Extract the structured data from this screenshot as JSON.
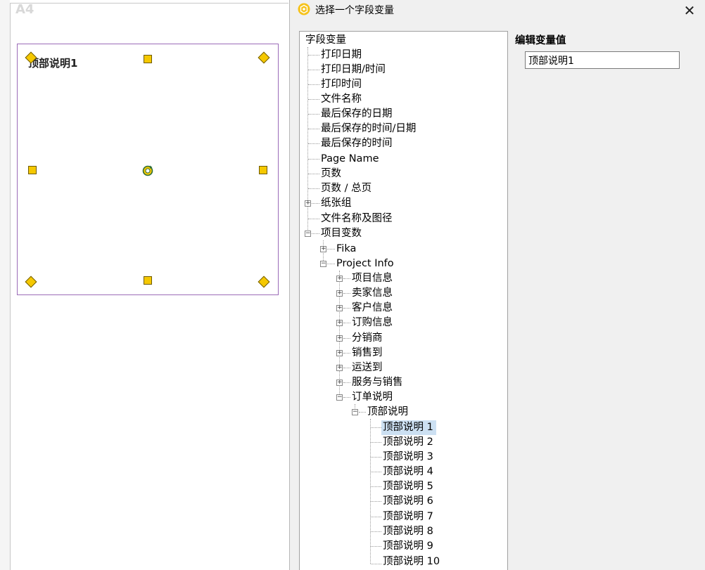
{
  "canvas": {
    "sheet_label": "A4",
    "frame_text": "顶部说明1"
  },
  "dialog": {
    "title": "选择一个字段变量",
    "close_label": "✕",
    "value_label": "编辑变量值",
    "value_input": "顶部说明1"
  },
  "tree": {
    "root": "字段变量",
    "items": [
      {
        "label": "打印日期"
      },
      {
        "label": "打印日期/时间"
      },
      {
        "label": "打印时间"
      },
      {
        "label": "文件名称"
      },
      {
        "label": "最后保存的日期"
      },
      {
        "label": "最后保存的时间/日期"
      },
      {
        "label": "最后保存的时间"
      },
      {
        "label": "Page Name"
      },
      {
        "label": "页数"
      },
      {
        "label": "页数 / 总页"
      },
      {
        "label": "纸张组"
      },
      {
        "label": "文件名称及图径"
      },
      {
        "label": "项目变数"
      },
      {
        "label": "Fika"
      },
      {
        "label": "Project Info"
      },
      {
        "label": "项目信息"
      },
      {
        "label": "卖家信息"
      },
      {
        "label": "客户信息"
      },
      {
        "label": "订购信息"
      },
      {
        "label": "分销商"
      },
      {
        "label": "销售到"
      },
      {
        "label": "运送到"
      },
      {
        "label": "服务与销售"
      },
      {
        "label": "订单说明"
      },
      {
        "label": "顶部说明"
      },
      {
        "label": "顶部说明 1"
      },
      {
        "label": "顶部说明 2"
      },
      {
        "label": "顶部说明 3"
      },
      {
        "label": "顶部说明 4"
      },
      {
        "label": "顶部说明 5"
      },
      {
        "label": "顶部说明 6"
      },
      {
        "label": "顶部说明 7"
      },
      {
        "label": "顶部说明 8"
      },
      {
        "label": "顶部说明 9"
      },
      {
        "label": "顶部说明 10"
      }
    ]
  }
}
